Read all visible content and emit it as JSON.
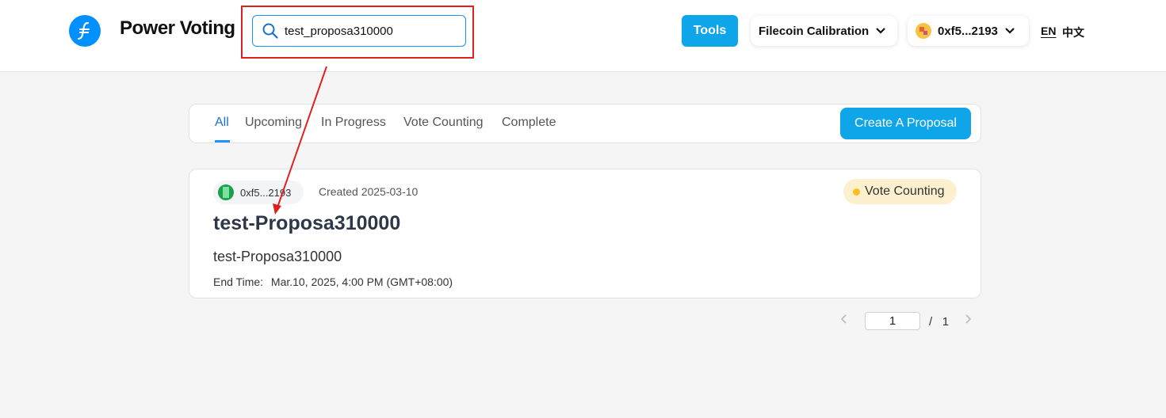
{
  "header": {
    "app_title": "Power Voting",
    "search": {
      "value": "test_proposa310000"
    },
    "tools_label": "Tools",
    "network_label": "Filecoin Calibration",
    "wallet_label": "0xf5...2193",
    "lang_en": "EN",
    "lang_zh": "中文"
  },
  "tabs": [
    {
      "label": "All",
      "active": true
    },
    {
      "label": "Upcoming"
    },
    {
      "label": "In Progress"
    },
    {
      "label": "Vote Counting"
    },
    {
      "label": "Complete"
    }
  ],
  "create_button_label": "Create A Proposal",
  "proposal": {
    "author": "0xf5...2193",
    "created": "Created 2025-03-10",
    "status": "Vote Counting",
    "title": "test-Proposa310000",
    "description": "test-Proposa310000",
    "end_time_label": "End Time:",
    "end_time_value": "Mar.10, 2025, 4:00 PM (GMT+08:00)"
  },
  "pagination": {
    "current": "1",
    "separator": "/",
    "total": "1"
  },
  "colors": {
    "accent": "#0ea5e9",
    "highlight": "#e02020",
    "status_bg": "#fdf0cf",
    "status_dot": "#fbbf24"
  }
}
